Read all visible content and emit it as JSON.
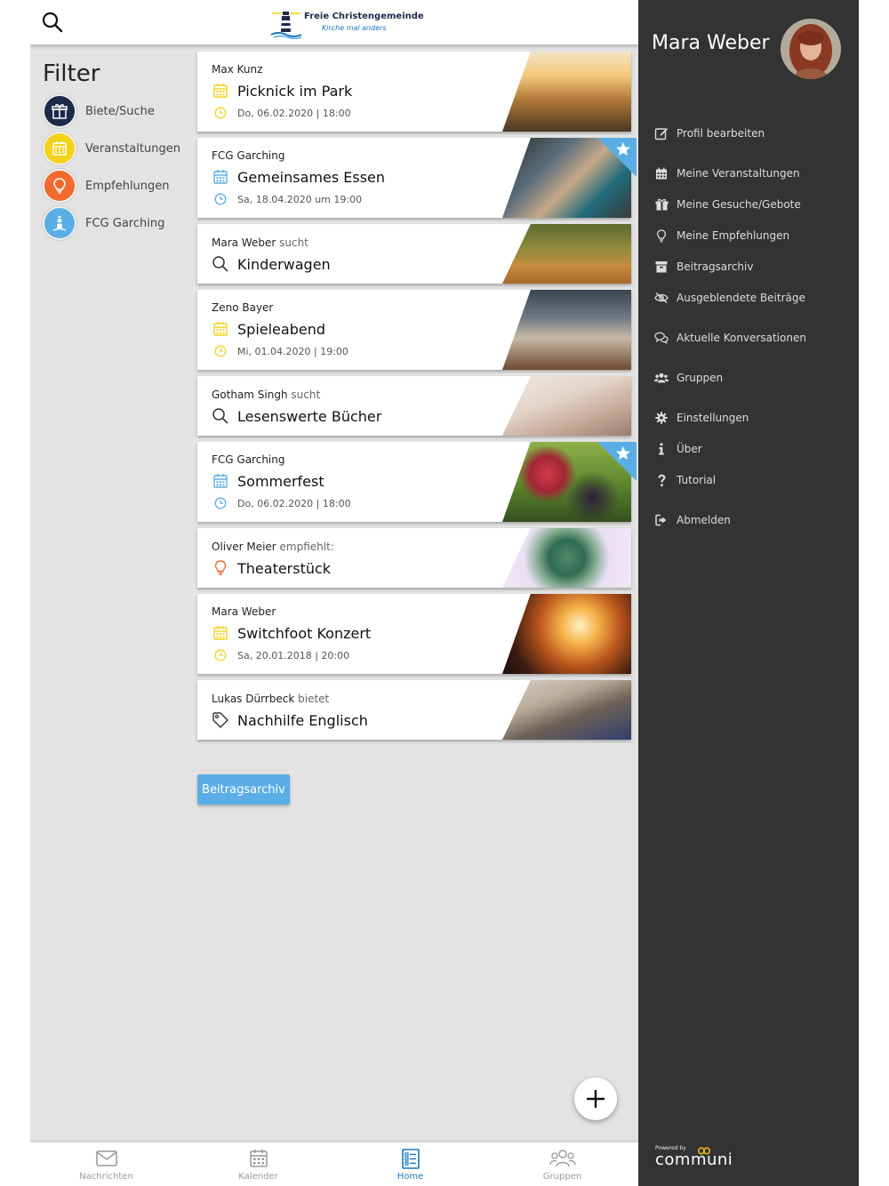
{
  "header": {
    "logo_line1": "Freie Christengemeinde",
    "logo_line2": "Kirche mal anders"
  },
  "filter": {
    "title": "Filter",
    "items": [
      {
        "label": "Biete/Suche",
        "icon": "gift-icon",
        "color": "#1d2b4a"
      },
      {
        "label": "Veranstaltungen",
        "icon": "calendar-icon",
        "color": "#f2d21b"
      },
      {
        "label": "Empfehlungen",
        "icon": "lightbulb-icon",
        "color": "#f26a2e"
      },
      {
        "label": "FCG Garching",
        "icon": "lighthouse-icon",
        "color": "#5aaee5"
      }
    ]
  },
  "feed": [
    {
      "author": "Max Kunz",
      "verb": "",
      "title": "Picknick im Park",
      "date": "Do, 06.02.2020 | 18:00",
      "type": "event",
      "color": "yellow",
      "image": "picnic-park-image",
      "starred": false
    },
    {
      "author": "FCG Garching",
      "verb": "",
      "title": "Gemeinsames Essen",
      "date": "Sa, 18.04.2020 um 19:00",
      "type": "event",
      "color": "blue",
      "image": "women-dining-image",
      "starred": true
    },
    {
      "author": "Mara Weber",
      "verb": " sucht",
      "title": "Kinderwagen",
      "date": "",
      "type": "search",
      "image": "family-walk-image",
      "starred": false
    },
    {
      "author": "Zeno Bayer",
      "verb": "",
      "title": "Spieleabend",
      "date": "Mi, 01.04.2020 | 19:00",
      "type": "event",
      "color": "yellow",
      "image": "chess-game-image",
      "starred": false
    },
    {
      "author": "Gotham Singh",
      "verb": " sucht",
      "title": "Lesenswerte Bücher",
      "date": "",
      "type": "search",
      "image": "book-pages-image",
      "starred": false
    },
    {
      "author": "FCG Garching",
      "verb": "",
      "title": "Sommerfest",
      "date": "Do, 06.02.2020 | 18:00",
      "type": "event",
      "color": "blue",
      "image": "berries-glass-image",
      "starred": true
    },
    {
      "author": "Oliver Meier",
      "verb": " empfiehlt:",
      "title": "Theaterstück",
      "date": "",
      "type": "recommend",
      "image": "succulent-image",
      "starred": false
    },
    {
      "author": "Mara Weber",
      "verb": "",
      "title": "Switchfoot Konzert",
      "date": "Sa, 20.01.2018 | 20:00",
      "type": "event",
      "color": "yellow",
      "image": "concert-image",
      "starred": false
    },
    {
      "author": "Lukas Dürrbeck",
      "verb": " bietet",
      "title": "Nachhilfe Englisch",
      "date": "",
      "type": "offer",
      "image": "writing-notebook-image",
      "starred": false
    }
  ],
  "archive_button": "Beitragsarchiv",
  "bottom_nav": [
    {
      "label": "Nachrichten",
      "icon": "mail-icon",
      "active": false
    },
    {
      "label": "Kalender",
      "icon": "calendar-icon",
      "active": false
    },
    {
      "label": "Home",
      "icon": "list-icon",
      "active": true
    },
    {
      "label": "Gruppen",
      "icon": "users-icon",
      "active": false
    }
  ],
  "drawer": {
    "user_name": "Mara Weber",
    "menu": [
      {
        "label": "Profil bearbeiten",
        "icon": "edit-icon"
      },
      {
        "label": "Meine Veranstaltungen",
        "icon": "calendar-icon"
      },
      {
        "label": "Meine Gesuche/Gebote",
        "icon": "gift-icon"
      },
      {
        "label": "Meine Empfehlungen",
        "icon": "lightbulb-icon"
      },
      {
        "label": "Beitragsarchiv",
        "icon": "archive-icon"
      },
      {
        "label": "Ausgeblendete Beiträge",
        "icon": "eye-slash-icon"
      },
      {
        "label": "Aktuelle Konversationen",
        "icon": "chat-icon"
      },
      {
        "label": "Gruppen",
        "icon": "users-icon"
      },
      {
        "label": "Einstellungen",
        "icon": "gear-icon"
      },
      {
        "label": "Über",
        "icon": "info-icon"
      },
      {
        "label": "Tutorial",
        "icon": "question-icon"
      },
      {
        "label": "Abmelden",
        "icon": "logout-icon"
      }
    ],
    "powered_by": "Powered by",
    "brand": "communi"
  },
  "colors": {
    "accent_blue": "#5aaee5",
    "drawer_bg": "#333333",
    "content_bg": "#e3e3e3",
    "event_yellow": "#f2d21b",
    "event_blue": "#5aaee5",
    "recommend_orange": "#f26a2e",
    "nav_active": "#1a76c2"
  }
}
